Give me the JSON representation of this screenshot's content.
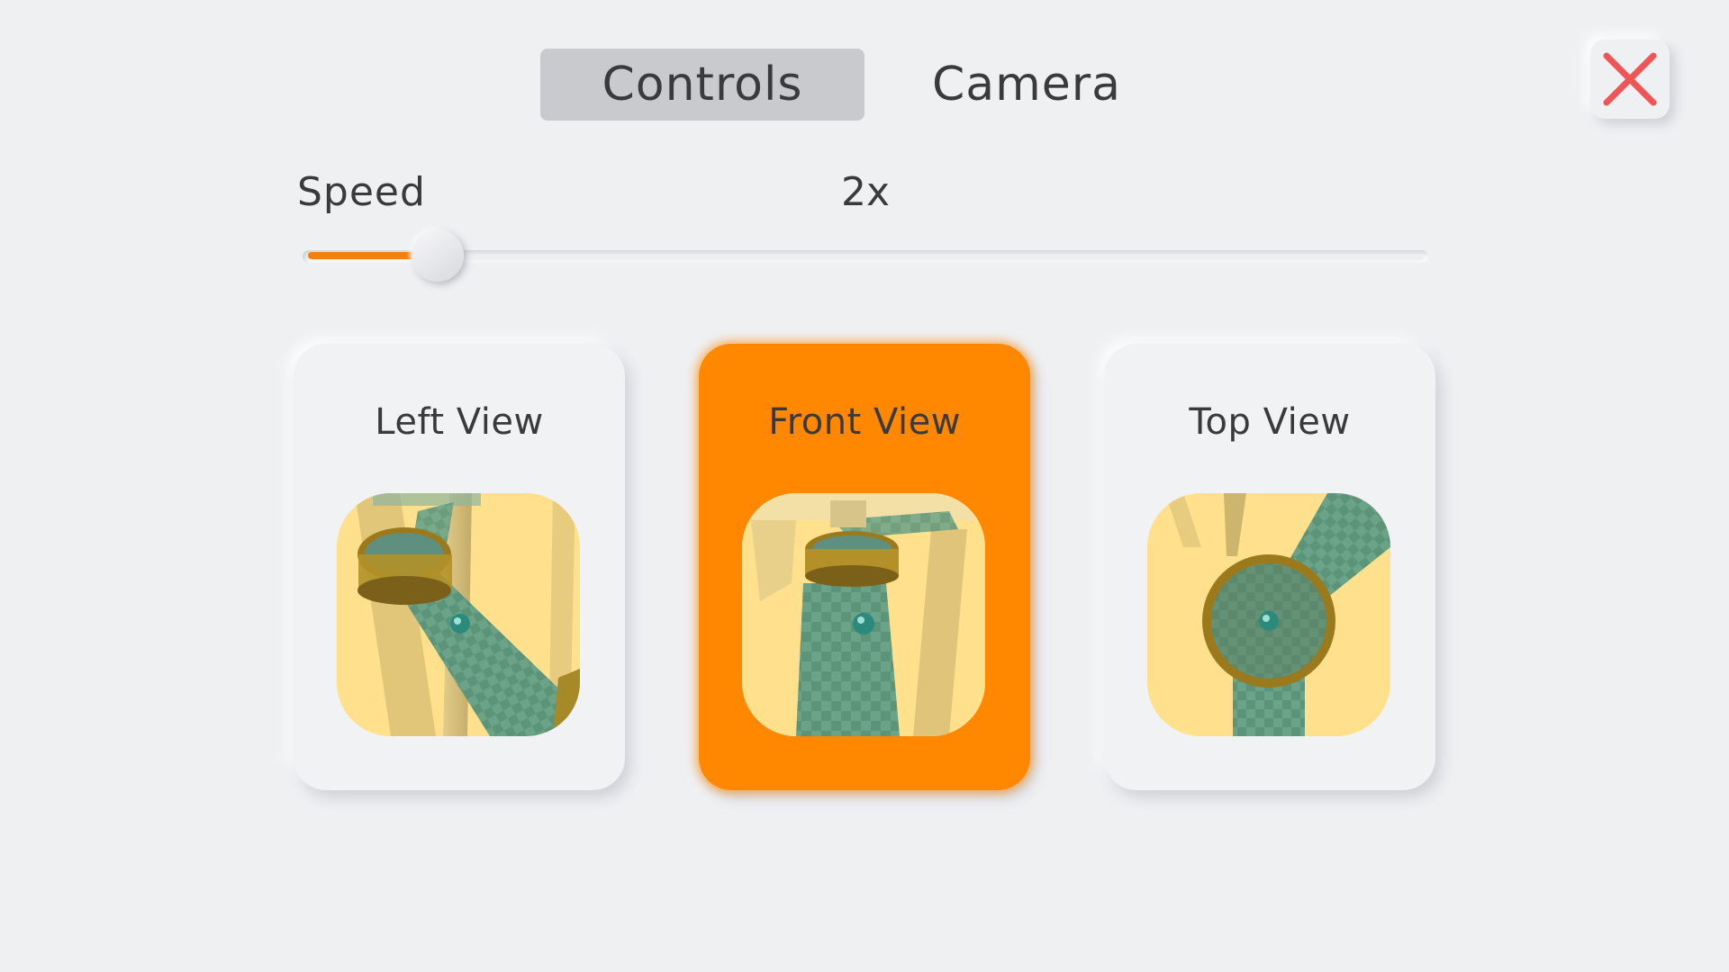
{
  "tabs": [
    {
      "label": "Controls",
      "active": true
    },
    {
      "label": "Camera",
      "active": false
    }
  ],
  "close": {
    "icon": "close-icon",
    "color": "#f05555"
  },
  "speed": {
    "label": "Speed",
    "value_text": "2x",
    "level": 0.12,
    "fill_color": "#f0810f"
  },
  "views": [
    {
      "title": "Left View",
      "icon": "left-view-thumbnail",
      "selected": false
    },
    {
      "title": "Front View",
      "icon": "front-view-thumbnail",
      "selected": true
    },
    {
      "title": "Top View",
      "icon": "top-view-thumbnail",
      "selected": false
    }
  ],
  "colors": {
    "background": "#eff0f2",
    "accent": "#ff8800",
    "tab_active": "#c9cacd",
    "thumbnail_bg": "#ffe08d",
    "track_green": "#6aa387"
  }
}
